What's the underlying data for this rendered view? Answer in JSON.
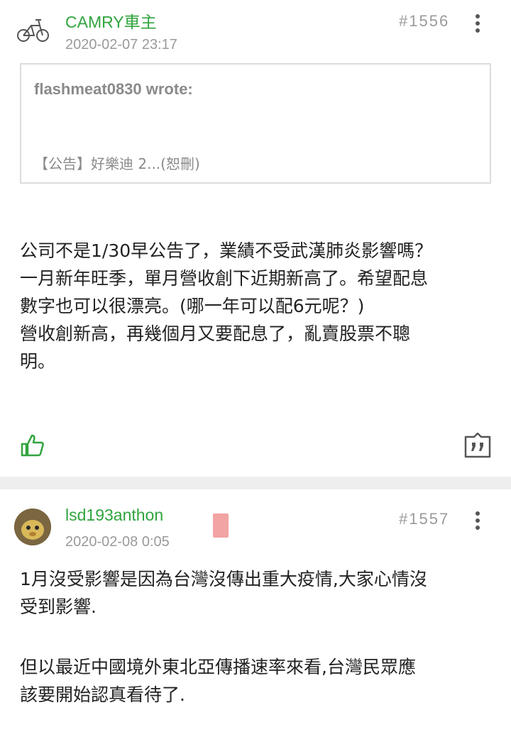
{
  "posts": [
    {
      "username": "CAMRY車主",
      "time": "2020-02-07 23:17",
      "number": "#1556",
      "avatar_icon": "bicycle-icon",
      "quote": {
        "author": "flashmeat0830 wrote:",
        "text": "【公告】好樂迪 2...(恕刪)"
      },
      "body": [
        "公司不是1/30早公告了，業績不受武漢肺炎影響嗎？",
        "一月新年旺季，單月營收創下近期新高了。希望配息",
        "數字也可以很漂亮。(哪一年可以配6元呢？)",
        "營收創新高，再幾個月又要配息了，亂賣股票不聰",
        "明。"
      ]
    },
    {
      "username": "lsd193anthon",
      "time": "2020-02-08 0:05",
      "number": "#1557",
      "avatar_icon": "user-photo-icon",
      "body": [
        "1月沒受影響是因為台灣沒傳出重大疫情,大家心情沒",
        "受到影響.",
        "",
        "但以最近中國境外東北亞傳播速率來看,台灣民眾應",
        "該要開始認真看待了."
      ]
    }
  ],
  "colors": {
    "accent": "#31a43f",
    "muted": "#9a9a9a",
    "divider": "#eeeeee"
  }
}
